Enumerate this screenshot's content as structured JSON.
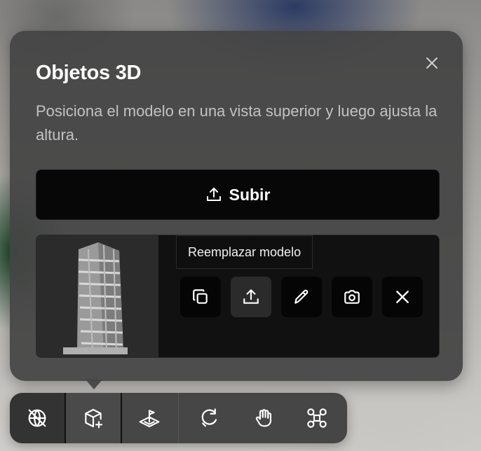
{
  "panel": {
    "title": "Objetos 3D",
    "description": "Posiciona el modelo en una vista superior y luego ajusta la altura.",
    "upload_label": "Subir",
    "close_icon": "close-icon"
  },
  "model_card": {
    "tooltip": "Reemplazar modelo",
    "actions": [
      {
        "name": "duplicate-button",
        "icon": "copy-icon"
      },
      {
        "name": "replace-model-button",
        "icon": "upload-icon",
        "active": true
      },
      {
        "name": "edit-button",
        "icon": "pencil-icon"
      },
      {
        "name": "camera-button",
        "icon": "camera-icon"
      },
      {
        "name": "remove-button",
        "icon": "close-icon"
      }
    ]
  },
  "toolbar": {
    "tools": [
      {
        "name": "globe-tool",
        "icon": "globe-off-icon"
      },
      {
        "name": "3d-object-tool",
        "icon": "cube-plus-icon",
        "selected": true
      },
      {
        "name": "place-marker-tool",
        "icon": "flag-plane-icon"
      },
      {
        "name": "rotate-tool",
        "icon": "rotate-icon"
      },
      {
        "name": "pan-tool",
        "icon": "hand-icon"
      },
      {
        "name": "move-tool",
        "icon": "drone-icon"
      }
    ]
  },
  "colors": {
    "panel_bg": "#444444",
    "button_bg": "#070707",
    "text_primary": "#ffffff",
    "text_secondary": "#c2c2c2"
  }
}
